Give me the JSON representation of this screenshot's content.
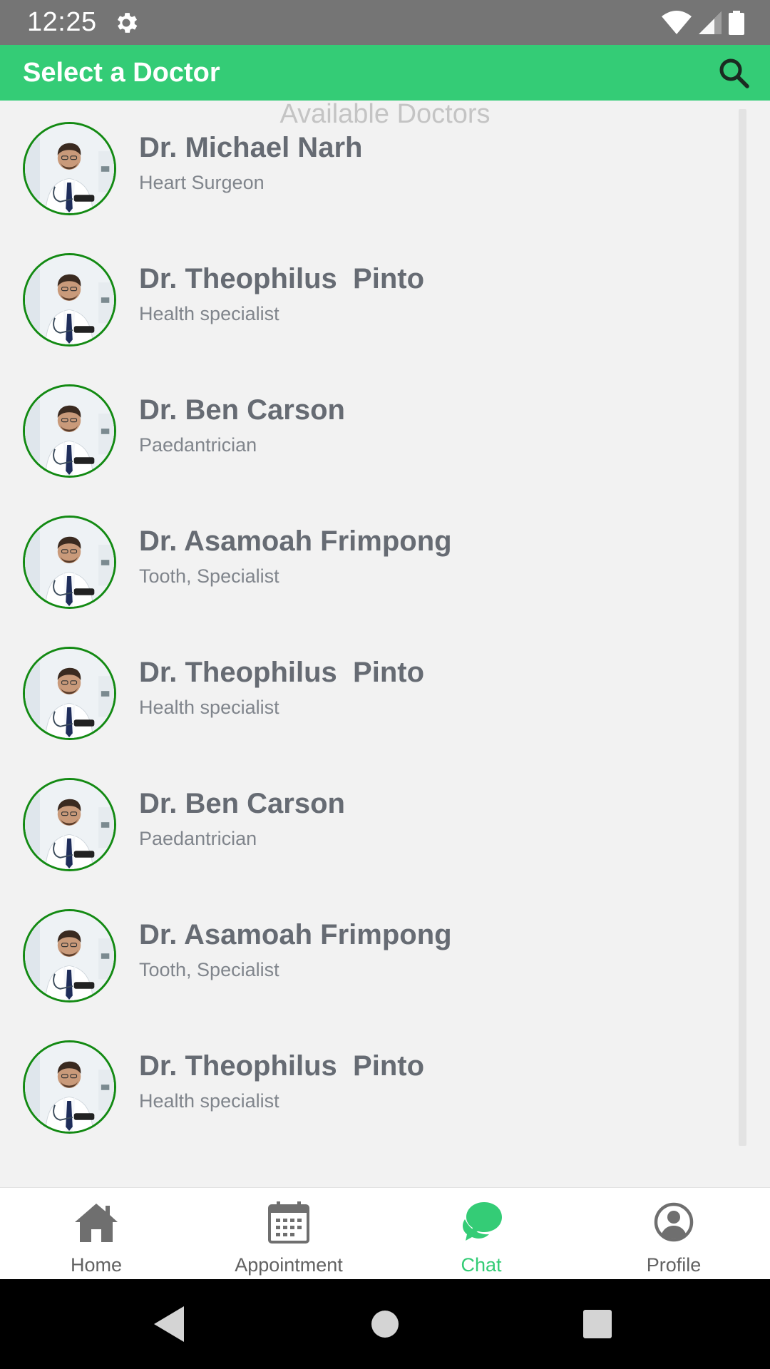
{
  "status_bar": {
    "time": "12:25"
  },
  "app_bar": {
    "title": "Select a Doctor"
  },
  "list": {
    "heading": "Available Doctors",
    "doctors": [
      {
        "name": "Dr. Michael Narh",
        "specialty": "Heart Surgeon"
      },
      {
        "name": "Dr. Theophilus  Pinto",
        "specialty": "Health specialist"
      },
      {
        "name": "Dr. Ben Carson",
        "specialty": "Paedantrician"
      },
      {
        "name": "Dr. Asamoah Frimpong",
        "specialty": "Tooth, Specialist"
      },
      {
        "name": "Dr. Theophilus  Pinto",
        "specialty": "Health specialist"
      },
      {
        "name": "Dr. Ben Carson",
        "specialty": "Paedantrician"
      },
      {
        "name": "Dr. Asamoah Frimpong",
        "specialty": "Tooth, Specialist"
      },
      {
        "name": "Dr. Theophilus  Pinto",
        "specialty": "Health specialist"
      }
    ]
  },
  "bottom_nav": {
    "items": [
      {
        "label": "Home",
        "icon": "home-icon"
      },
      {
        "label": "Appointment",
        "icon": "calendar-icon"
      },
      {
        "label": "Chat",
        "icon": "chat-icon",
        "active": true
      },
      {
        "label": "Profile",
        "icon": "profile-icon"
      }
    ]
  },
  "colors": {
    "accent": "#34cc76",
    "status_bar": "#757575",
    "avatar_border": "#138a13",
    "name_text": "#666b73"
  }
}
